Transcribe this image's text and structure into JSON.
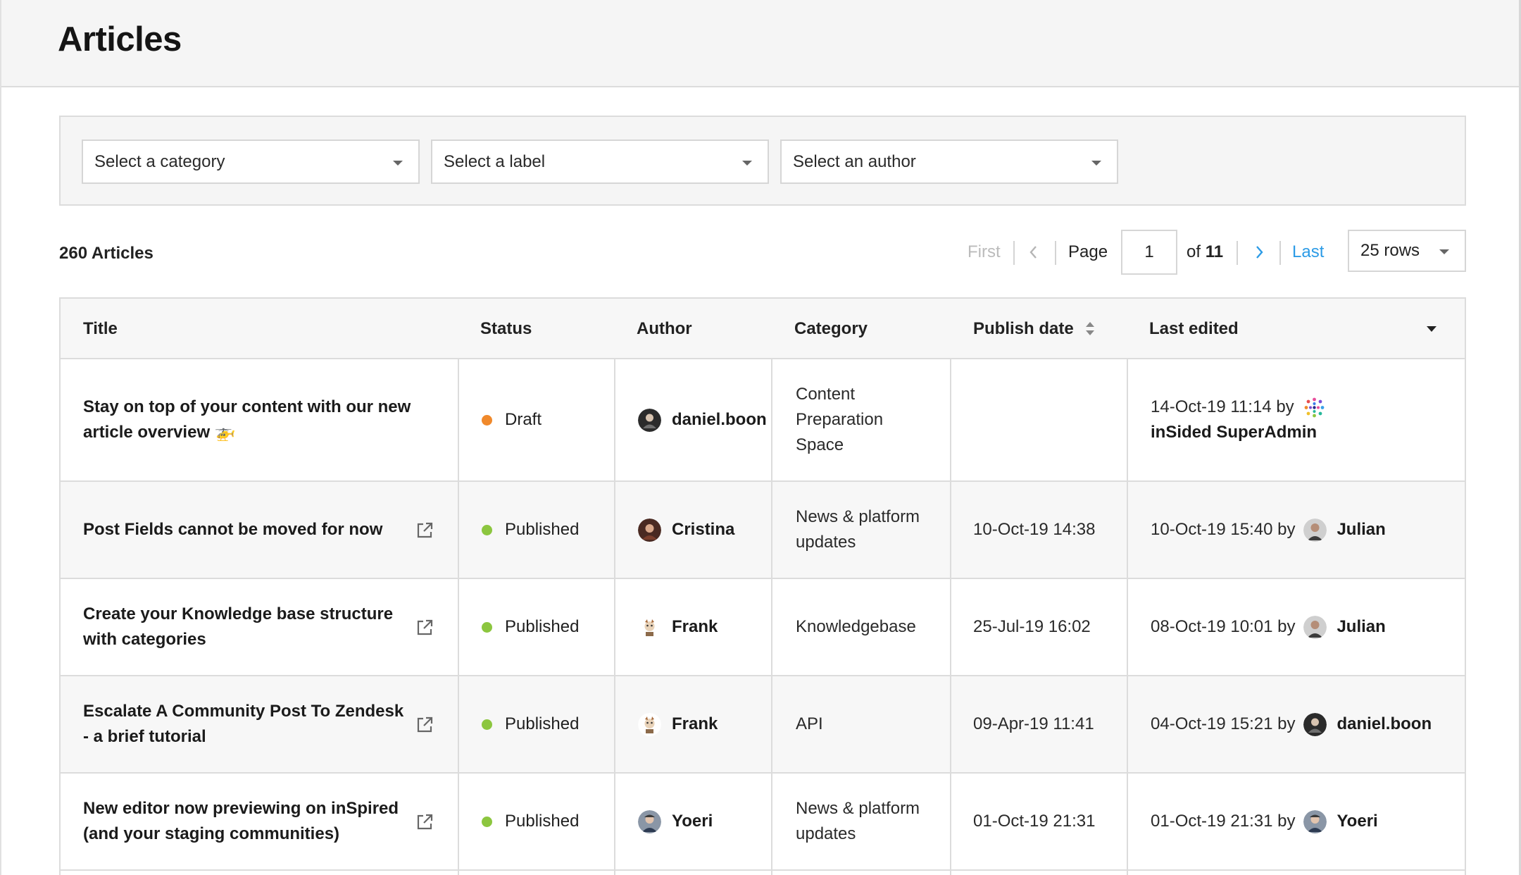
{
  "header": {
    "title": "Articles"
  },
  "filters": {
    "category": "Select a category",
    "label": "Select a label",
    "author": "Select an author"
  },
  "summary": {
    "count_label": "260 Articles"
  },
  "pagination": {
    "first": "First",
    "page_label": "Page",
    "current_page": "1",
    "of_label": "of",
    "total_pages": "11",
    "last": "Last",
    "rows": "25 rows"
  },
  "table": {
    "columns": {
      "title": "Title",
      "status": "Status",
      "author": "Author",
      "category": "Category",
      "publish_date": "Publish date",
      "last_edited": "Last edited"
    },
    "rows": [
      {
        "title": "Stay on top of your content with our new article overview 🚁",
        "status": "Draft",
        "status_color": "#f0892b",
        "author": "daniel.boon",
        "category": "Content Preparation Space",
        "publish_date": "",
        "edited_date": "14-Oct-19 11:14 by",
        "edited_by": "inSided SuperAdmin"
      },
      {
        "title": "Post Fields cannot be moved for now",
        "status": "Published",
        "status_color": "#8cc63f",
        "author": "Cristina",
        "category": "News & platform updates",
        "publish_date": "10-Oct-19 14:38",
        "edited_date": "10-Oct-19 15:40 by",
        "edited_by": "Julian"
      },
      {
        "title": "Create your Knowledge base structure with categories",
        "status": "Published",
        "status_color": "#8cc63f",
        "author": "Frank",
        "category": "Knowledgebase",
        "publish_date": "25-Jul-19 16:02",
        "edited_date": "08-Oct-19 10:01 by",
        "edited_by": "Julian"
      },
      {
        "title": "Escalate A Community Post To Zendesk - a brief tutorial",
        "status": "Published",
        "status_color": "#8cc63f",
        "author": "Frank",
        "category": "API",
        "publish_date": "09-Apr-19 11:41",
        "edited_date": "04-Oct-19 15:21 by",
        "edited_by": "daniel.boon"
      },
      {
        "title": "New editor now previewing on inSpired (and your staging communities)",
        "status": "Published",
        "status_color": "#8cc63f",
        "author": "Yoeri",
        "category": "News & platform updates",
        "publish_date": "01-Oct-19 21:31",
        "edited_date": "01-Oct-19 21:31 by",
        "edited_by": "Yoeri"
      }
    ]
  },
  "colors": {
    "link": "#2c9be6",
    "draft": "#f0892b",
    "published": "#8cc63f"
  }
}
